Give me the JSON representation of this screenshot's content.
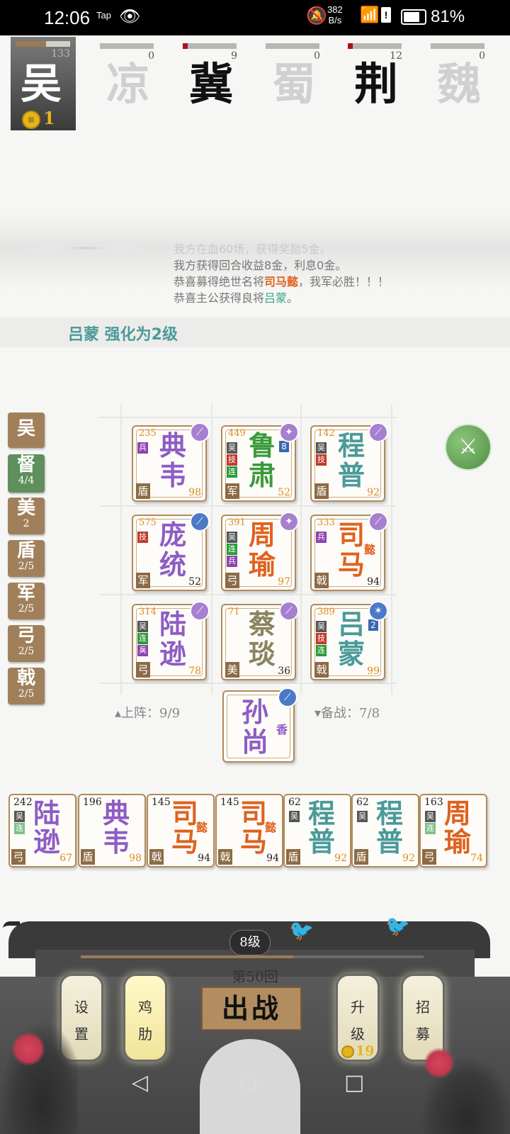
{
  "status_bar": {
    "time": "12:06",
    "tap_label": "Tap",
    "speed_value": "382",
    "speed_unit": "B/s",
    "battery_percent": "81%",
    "sim_mark": "!"
  },
  "kingdoms": [
    {
      "name": "吴",
      "score": "133",
      "gold": "1"
    },
    {
      "name": "凉",
      "score": "0"
    },
    {
      "name": "冀",
      "score": "9"
    },
    {
      "name": "蜀",
      "score": "0"
    },
    {
      "name": "荆",
      "score": "12"
    },
    {
      "name": "魏",
      "score": "0"
    }
  ],
  "log": {
    "line0": "我方在血60场，获得奖励5金。",
    "line1": "我方获得回合收益8金，利息0金。",
    "line2_pre": "恭喜募得绝世名将",
    "line2_hero": "司马懿",
    "line2_post": "，我军必胜！！！",
    "line3_pre": "恭喜主公获得良将",
    "line3_hero": "吕蒙",
    "line3_post": "。"
  },
  "banner": "吕蒙 强化为2级",
  "synergies": [
    {
      "title": "吴",
      "count": ""
    },
    {
      "title": "督",
      "count": "4/4"
    },
    {
      "title": "美",
      "count": "2"
    },
    {
      "title": "盾",
      "count": "2/5"
    },
    {
      "title": "军",
      "count": "2/5"
    },
    {
      "title": "弓",
      "count": "2/5"
    },
    {
      "title": "戟",
      "count": "2/5"
    }
  ],
  "board": [
    {
      "l1": "典",
      "l2": "韦",
      "hp": "235",
      "badges": [
        "兵"
      ],
      "type": "盾",
      "power": "98"
    },
    {
      "l1": "鲁",
      "l2": "肃",
      "hp": "449",
      "badges": [
        "吴",
        "技",
        "连"
      ],
      "type": "军",
      "power": "52",
      "level": "8"
    },
    {
      "l1": "程",
      "l2": "普",
      "hp": "142",
      "badges": [
        "吴",
        "技"
      ],
      "type": "盾",
      "power": "92"
    },
    {
      "l1": "庞",
      "l2": "统",
      "hp": "575",
      "badges": [
        "技"
      ],
      "type": "军",
      "power": "52"
    },
    {
      "l1": "周",
      "l2": "瑜",
      "hp": "391",
      "badges": [
        "吴",
        "连",
        "兵"
      ],
      "type": "弓",
      "power": "97"
    },
    {
      "l1": "司",
      "l2": "马",
      "suffix": "懿",
      "hp": "333",
      "badges": [
        "兵"
      ],
      "type": "戟",
      "power": "94"
    },
    {
      "l1": "陆",
      "l2": "逊",
      "hp": "314",
      "badges": [
        "吴",
        "连₂",
        "兵"
      ],
      "type": "弓",
      "power": "78"
    },
    {
      "l1": "蔡",
      "l2": "琰",
      "hp": "71",
      "badges": [],
      "type": "美",
      "power": "36"
    },
    {
      "l1": "吕",
      "l2": "蒙",
      "hp": "389",
      "badges": [
        "吴",
        "技",
        "连₂"
      ],
      "type": "戟",
      "power": "99",
      "level": "2"
    }
  ],
  "extra_card": {
    "l1": "孙",
    "l2": "尚",
    "suffix": "香"
  },
  "deploy_label": "上阵：9/9",
  "bench_label": "备战：7/8",
  "bench": [
    {
      "l1": "陆",
      "l2": "逊",
      "hp": "242",
      "badges": [
        "吴",
        "连"
      ],
      "type": "弓",
      "power": "67"
    },
    {
      "l1": "典",
      "l2": "韦",
      "hp": "196",
      "badges": [],
      "type": "盾",
      "power": "98"
    },
    {
      "l1": "司",
      "l2": "马",
      "suffix": "懿",
      "hp": "145",
      "badges": [],
      "type": "戟",
      "power": "94"
    },
    {
      "l1": "司",
      "l2": "马",
      "suffix": "懿",
      "hp": "145",
      "badges": [],
      "type": "戟",
      "power": "94"
    },
    {
      "l1": "程",
      "l2": "普",
      "hp": "62",
      "badges": [
        "吴"
      ],
      "type": "盾",
      "power": "92"
    },
    {
      "l1": "程",
      "l2": "普",
      "hp": "62",
      "badges": [
        "吴"
      ],
      "type": "盾",
      "power": "92"
    },
    {
      "l1": "周",
      "l2": "瑜",
      "hp": "163",
      "badges": [
        "吴",
        "连"
      ],
      "type": "弓",
      "power": "74"
    }
  ],
  "footer": {
    "level": "8级",
    "xp_fraction": 0.62,
    "round": "第50回",
    "battle": "出战",
    "settings_1": "设",
    "settings_2": "置",
    "cheat_1": "鸡",
    "cheat_2": "肋",
    "upgrade_1": "升",
    "upgrade_2": "级",
    "upgrade_cost": "19",
    "recruit_1": "招",
    "recruit_2": "募"
  },
  "icons": {
    "eye": "eye-icon",
    "bell": "bell-off-icon",
    "wifi": "wifi-icon",
    "skill": "sword-skill-icon",
    "back": "nav-back-icon",
    "home": "nav-home-icon",
    "recent": "nav-recent-icon"
  },
  "colors": {
    "accent_wood": "#b08a5c",
    "banner_text": "#4d9a9a",
    "gold": "#e6b421",
    "active_synergy": "#5f8f5c"
  }
}
